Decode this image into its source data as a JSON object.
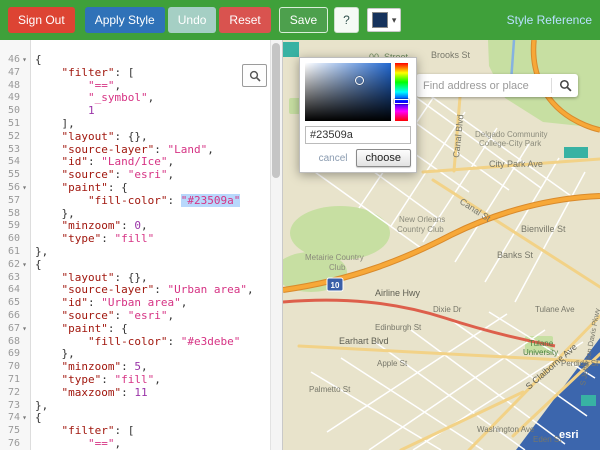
{
  "header": {
    "buttons": {
      "sign_out": "Sign Out",
      "apply_style": "Apply Style",
      "undo": "Undo",
      "reset": "Reset",
      "save": "Save",
      "help": "?"
    },
    "style_reference": "Style Reference",
    "swatch_color": "#16325c",
    "bar_color": "#3fa03a"
  },
  "color_picker": {
    "hex_value": "#23509a",
    "cancel_label": "cancel",
    "choose_label": "choose"
  },
  "editor": {
    "selected_value": "#23509a",
    "lines": [
      {
        "num": 46,
        "fold": true,
        "tokens": [
          {
            "t": "p",
            "v": "{"
          }
        ]
      },
      {
        "num": 47,
        "fold": false,
        "tokens": [
          {
            "t": "p",
            "v": "    "
          },
          {
            "t": "k",
            "v": "\"filter\""
          },
          {
            "t": "p",
            "v": ": ["
          }
        ]
      },
      {
        "num": 48,
        "fold": false,
        "tokens": [
          {
            "t": "p",
            "v": "        "
          },
          {
            "t": "s",
            "v": "\"==\""
          },
          {
            "t": "p",
            "v": ","
          }
        ]
      },
      {
        "num": 49,
        "fold": false,
        "tokens": [
          {
            "t": "p",
            "v": "        "
          },
          {
            "t": "s",
            "v": "\"_symbol\""
          },
          {
            "t": "p",
            "v": ","
          }
        ]
      },
      {
        "num": 50,
        "fold": false,
        "tokens": [
          {
            "t": "p",
            "v": "        "
          },
          {
            "t": "n",
            "v": "1"
          }
        ]
      },
      {
        "num": 51,
        "fold": false,
        "tokens": [
          {
            "t": "p",
            "v": "    ],"
          }
        ]
      },
      {
        "num": 52,
        "fold": false,
        "tokens": [
          {
            "t": "p",
            "v": "    "
          },
          {
            "t": "k",
            "v": "\"layout\""
          },
          {
            "t": "p",
            "v": ": {},"
          }
        ]
      },
      {
        "num": 53,
        "fold": false,
        "tokens": [
          {
            "t": "p",
            "v": "    "
          },
          {
            "t": "k",
            "v": "\"source-layer\""
          },
          {
            "t": "p",
            "v": ": "
          },
          {
            "t": "s",
            "v": "\"Land\""
          },
          {
            "t": "p",
            "v": ","
          }
        ]
      },
      {
        "num": 54,
        "fold": false,
        "tokens": [
          {
            "t": "p",
            "v": "    "
          },
          {
            "t": "k",
            "v": "\"id\""
          },
          {
            "t": "p",
            "v": ": "
          },
          {
            "t": "s",
            "v": "\"Land/Ice\""
          },
          {
            "t": "p",
            "v": ","
          }
        ]
      },
      {
        "num": 55,
        "fold": false,
        "tokens": [
          {
            "t": "p",
            "v": "    "
          },
          {
            "t": "k",
            "v": "\"source\""
          },
          {
            "t": "p",
            "v": ": "
          },
          {
            "t": "s",
            "v": "\"esri\""
          },
          {
            "t": "p",
            "v": ","
          }
        ]
      },
      {
        "num": 56,
        "fold": true,
        "tokens": [
          {
            "t": "p",
            "v": "    "
          },
          {
            "t": "k",
            "v": "\"paint\""
          },
          {
            "t": "p",
            "v": ": {"
          }
        ]
      },
      {
        "num": 57,
        "fold": false,
        "tokens": [
          {
            "t": "p",
            "v": "        "
          },
          {
            "t": "k",
            "v": "\"fill-color\""
          },
          {
            "t": "p",
            "v": ": "
          },
          {
            "t": "h",
            "v": "\"#23509a\""
          }
        ]
      },
      {
        "num": 58,
        "fold": false,
        "tokens": [
          {
            "t": "p",
            "v": "    },"
          }
        ]
      },
      {
        "num": 59,
        "fold": false,
        "tokens": [
          {
            "t": "p",
            "v": "    "
          },
          {
            "t": "k",
            "v": "\"minzoom\""
          },
          {
            "t": "p",
            "v": ": "
          },
          {
            "t": "n",
            "v": "0"
          },
          {
            "t": "p",
            "v": ","
          }
        ]
      },
      {
        "num": 60,
        "fold": false,
        "tokens": [
          {
            "t": "p",
            "v": "    "
          },
          {
            "t": "k",
            "v": "\"type\""
          },
          {
            "t": "p",
            "v": ": "
          },
          {
            "t": "s",
            "v": "\"fill\""
          }
        ]
      },
      {
        "num": 61,
        "fold": false,
        "tokens": [
          {
            "t": "p",
            "v": "},"
          }
        ]
      },
      {
        "num": 62,
        "fold": true,
        "tokens": [
          {
            "t": "p",
            "v": "{"
          }
        ]
      },
      {
        "num": 63,
        "fold": false,
        "tokens": [
          {
            "t": "p",
            "v": "    "
          },
          {
            "t": "k",
            "v": "\"layout\""
          },
          {
            "t": "p",
            "v": ": {},"
          }
        ]
      },
      {
        "num": 64,
        "fold": false,
        "tokens": [
          {
            "t": "p",
            "v": "    "
          },
          {
            "t": "k",
            "v": "\"source-layer\""
          },
          {
            "t": "p",
            "v": ": "
          },
          {
            "t": "s",
            "v": "\"Urban area\""
          },
          {
            "t": "p",
            "v": ","
          }
        ]
      },
      {
        "num": 65,
        "fold": false,
        "tokens": [
          {
            "t": "p",
            "v": "    "
          },
          {
            "t": "k",
            "v": "\"id\""
          },
          {
            "t": "p",
            "v": ": "
          },
          {
            "t": "s",
            "v": "\"Urban area\""
          },
          {
            "t": "p",
            "v": ","
          }
        ]
      },
      {
        "num": 66,
        "fold": false,
        "tokens": [
          {
            "t": "p",
            "v": "    "
          },
          {
            "t": "k",
            "v": "\"source\""
          },
          {
            "t": "p",
            "v": ": "
          },
          {
            "t": "s",
            "v": "\"esri\""
          },
          {
            "t": "p",
            "v": ","
          }
        ]
      },
      {
        "num": 67,
        "fold": true,
        "tokens": [
          {
            "t": "p",
            "v": "    "
          },
          {
            "t": "k",
            "v": "\"paint\""
          },
          {
            "t": "p",
            "v": ": {"
          }
        ]
      },
      {
        "num": 68,
        "fold": false,
        "tokens": [
          {
            "t": "p",
            "v": "        "
          },
          {
            "t": "k",
            "v": "\"fill-color\""
          },
          {
            "t": "p",
            "v": ": "
          },
          {
            "t": "s",
            "v": "\"#e3debe\""
          }
        ]
      },
      {
        "num": 69,
        "fold": false,
        "tokens": [
          {
            "t": "p",
            "v": "    },"
          }
        ]
      },
      {
        "num": 70,
        "fold": false,
        "tokens": [
          {
            "t": "p",
            "v": "    "
          },
          {
            "t": "k",
            "v": "\"minzoom\""
          },
          {
            "t": "p",
            "v": ": "
          },
          {
            "t": "n",
            "v": "5"
          },
          {
            "t": "p",
            "v": ","
          }
        ]
      },
      {
        "num": 71,
        "fold": false,
        "tokens": [
          {
            "t": "p",
            "v": "    "
          },
          {
            "t": "k",
            "v": "\"type\""
          },
          {
            "t": "p",
            "v": ": "
          },
          {
            "t": "s",
            "v": "\"fill\""
          },
          {
            "t": "p",
            "v": ","
          }
        ]
      },
      {
        "num": 72,
        "fold": false,
        "tokens": [
          {
            "t": "p",
            "v": "    "
          },
          {
            "t": "k",
            "v": "\"maxzoom\""
          },
          {
            "t": "p",
            "v": ": "
          },
          {
            "t": "n",
            "v": "11"
          }
        ]
      },
      {
        "num": 73,
        "fold": false,
        "tokens": [
          {
            "t": "p",
            "v": "},"
          }
        ]
      },
      {
        "num": 74,
        "fold": true,
        "tokens": [
          {
            "t": "p",
            "v": "{"
          }
        ]
      },
      {
        "num": 75,
        "fold": false,
        "tokens": [
          {
            "t": "p",
            "v": "    "
          },
          {
            "t": "k",
            "v": "\"filter\""
          },
          {
            "t": "p",
            "v": ": ["
          }
        ]
      },
      {
        "num": 76,
        "fold": false,
        "tokens": [
          {
            "t": "p",
            "v": "        "
          },
          {
            "t": "s",
            "v": "\"==\""
          },
          {
            "t": "p",
            "v": ","
          }
        ]
      }
    ]
  },
  "map": {
    "search": {
      "placeholder": "Find address or place"
    },
    "attribution": "esri",
    "shields": {
      "i10": "10"
    },
    "labels": {
      "street_00": "00_Street",
      "brooks_st": "Brooks St",
      "delgado_1": "Delgado Community",
      "delgado_2": "College-City Park",
      "city_park_ave": "City Park Ave",
      "canal_blvd": "Canal Blvd",
      "canal_st": "Canal St",
      "bienville_st": "Bienville St",
      "banks_st": "Banks St",
      "nocc_1": "New Orleans",
      "nocc_2": "Country Club",
      "metairie_1": "Metairie Country",
      "metairie_2": "Club",
      "airline_hwy": "Airline Hwy",
      "dixie": "Dixie Dr",
      "edinburgh_st": "Edinburgh St",
      "apple_st": "Apple St",
      "palmetto_st": "Palmetto St",
      "earhart_blvd": "Earhart Blvd",
      "s_claiborne": "S Claiborne Ave",
      "tulane_1": "Tulane",
      "tulane_2": "University",
      "perdido_st": "Perdido St",
      "tulane_ave": "Tulane Ave",
      "washington_ave": "Washington Ave",
      "eden_st": "Eden St",
      "s_jeff_davis": "S Jefferson Davis Pkwy"
    }
  }
}
